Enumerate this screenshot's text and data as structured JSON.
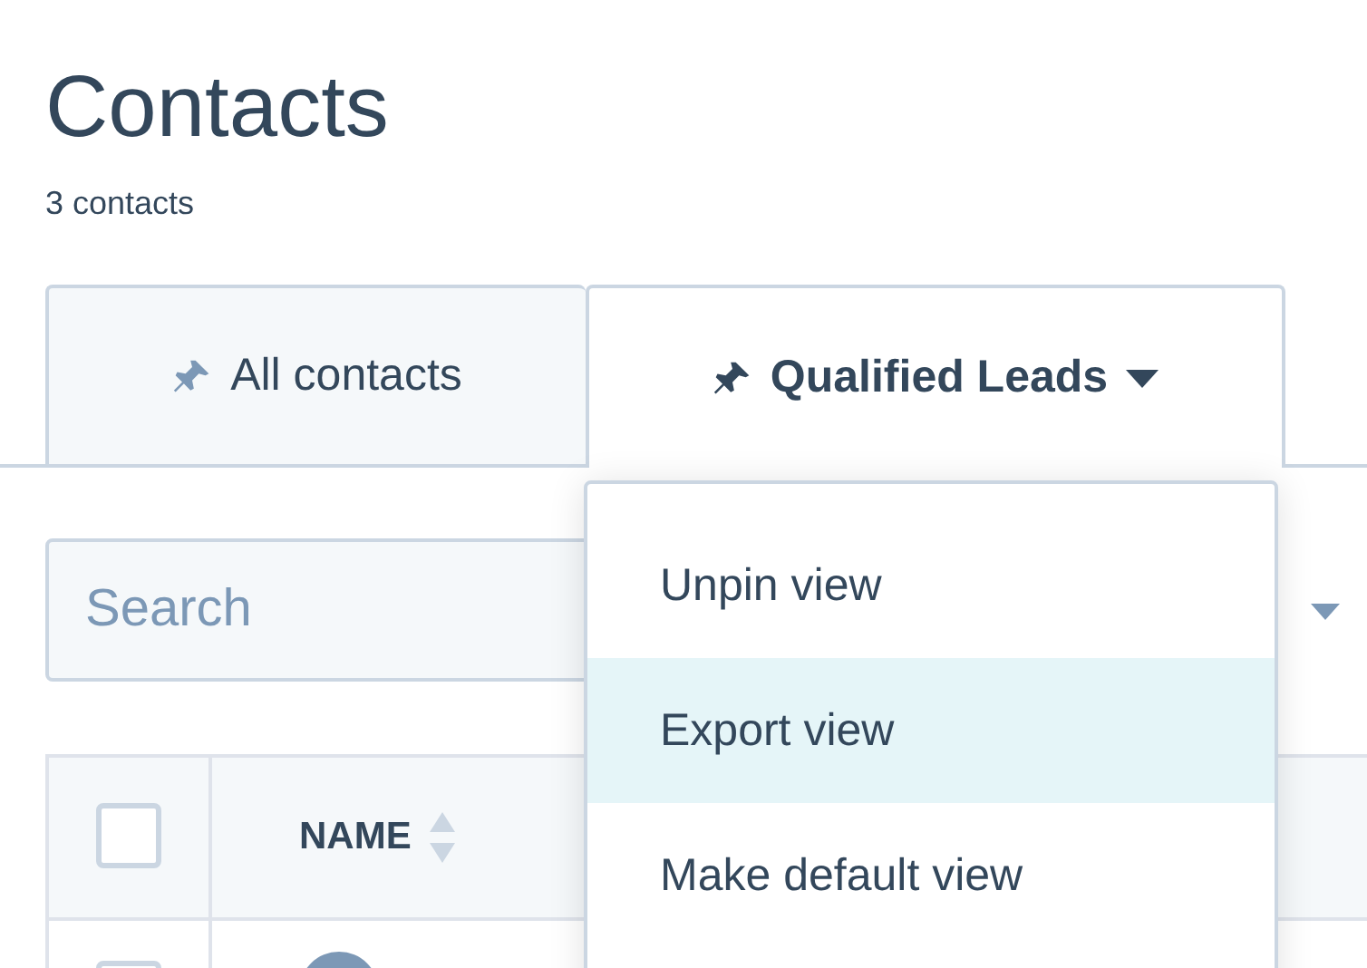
{
  "page": {
    "title": "Contacts",
    "subtitle": "3 contacts"
  },
  "tabs": [
    {
      "label": "All contacts",
      "selected": false,
      "has_menu": false
    },
    {
      "label": "Qualified Leads",
      "selected": true,
      "has_menu": true
    }
  ],
  "search": {
    "placeholder": "Search"
  },
  "table": {
    "select_all_checked": false,
    "columns": [
      {
        "label": "NAME",
        "sortable": true
      }
    ],
    "rows": [
      {
        "checked": false
      }
    ]
  },
  "view_menu": {
    "items": [
      {
        "label": "Unpin view",
        "selected": false
      },
      {
        "label": "Export view",
        "selected": true
      },
      {
        "label": "Make default view",
        "selected": false
      }
    ]
  }
}
